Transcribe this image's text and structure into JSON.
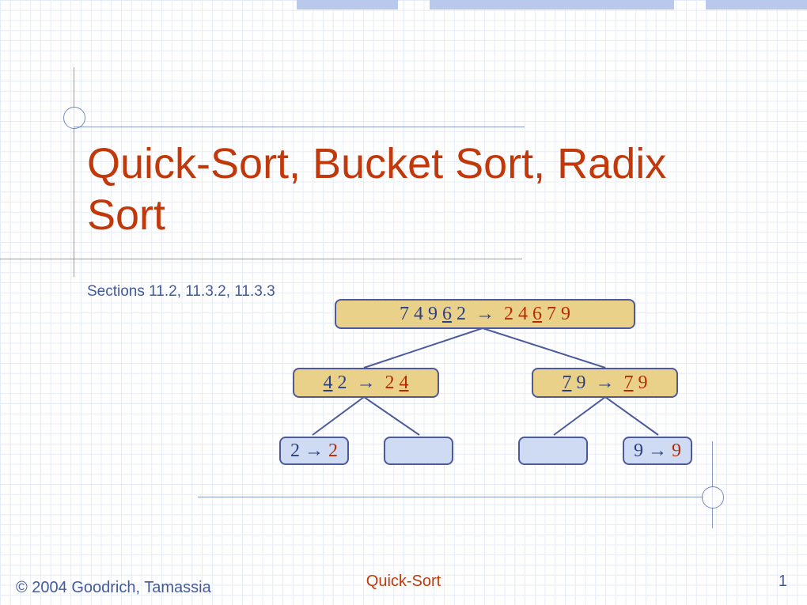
{
  "title": "Quick-Sort, Bucket Sort, Radix Sort",
  "sections_label": "Sections 11.2, 11.3.2, 11.3.3",
  "tree": {
    "root": {
      "left": [
        "7",
        "4",
        "9",
        "6",
        "2"
      ],
      "left_underline_index": 3,
      "right": [
        "2",
        "4",
        "6",
        "7",
        "9"
      ],
      "right_underline_index": 2
    },
    "L": {
      "left": [
        "4",
        "2"
      ],
      "left_underline_index": 0,
      "right": [
        "2",
        "4"
      ],
      "right_underline_index": 1
    },
    "R": {
      "left": [
        "7",
        "9"
      ],
      "left_underline_index": 0,
      "right": [
        "7",
        "9"
      ],
      "right_underline_index": 0
    },
    "LL": {
      "left": [
        "2"
      ],
      "right": [
        "2"
      ]
    },
    "RR": {
      "left": [
        "9"
      ],
      "right": [
        "9"
      ]
    }
  },
  "arrow": "→",
  "footer": {
    "left": "© 2004 Goodrich, Tamassia",
    "center": "Quick-Sort",
    "page": "1"
  }
}
